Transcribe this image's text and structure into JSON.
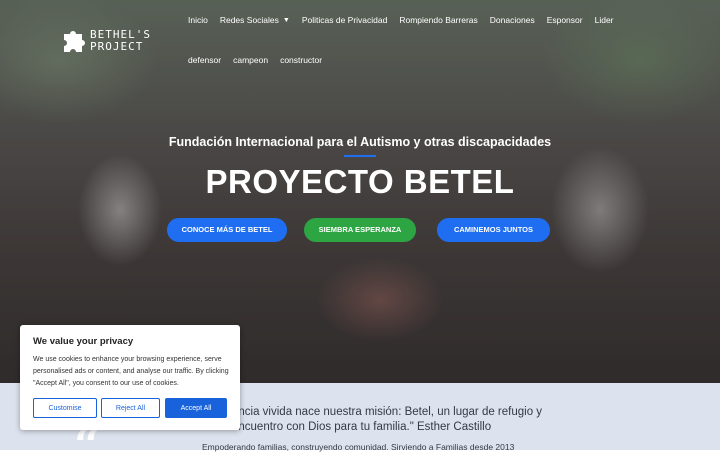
{
  "logo": {
    "text_line1": "BETHEL'S",
    "text_line2": "PROJECT"
  },
  "nav": {
    "row1": [
      {
        "label": "Inicio"
      },
      {
        "label": "Redes Sociales",
        "has_dropdown": true
      },
      {
        "label": "Politicas de Privacidad"
      },
      {
        "label": "Rompiendo Barreras"
      },
      {
        "label": "Donaciones"
      },
      {
        "label": "Esponsor"
      },
      {
        "label": "Lider"
      }
    ],
    "row2": [
      {
        "label": "defensor"
      },
      {
        "label": "campeon"
      },
      {
        "label": "constructor"
      }
    ],
    "caret_icon": "chevron-down-icon"
  },
  "hero": {
    "subtitle": "Fundación Internacional para el Autismo y otras discapacidades",
    "title": "PROYECTO BETEL",
    "buttons": [
      {
        "label": "CONOCE MÁS DE BETEL",
        "color": "#1f6ef2"
      },
      {
        "label": "SIEMBRA ESPERANZA",
        "color": "#2ea543"
      },
      {
        "label": "CAMINEMOS JUNTOS",
        "color": "#1f6ef2"
      }
    ]
  },
  "quote": {
    "line1": "encia vivida nace nuestra misión: Betel, un lugar de refugio y",
    "line2": "encuentro con Dios para tu familia.\" Esther Castillo",
    "cut_line": "Empoderando familias, construyendo comunidad. Sirviendo a Familias desde 2013"
  },
  "cookie_banner": {
    "title": "We value your privacy",
    "text": "We use cookies to enhance your browsing experience, serve personalised ads or content, and analyse our traffic. By clicking \"Accept All\", you consent to our use of cookies.",
    "customise_label": "Customise",
    "reject_label": "Reject All",
    "accept_label": "Accept All"
  },
  "colors": {
    "accent_blue": "#1f6ef2",
    "accent_green": "#2ea543",
    "cookie_blue": "#1863dc",
    "section_bg": "#dde3ee"
  }
}
